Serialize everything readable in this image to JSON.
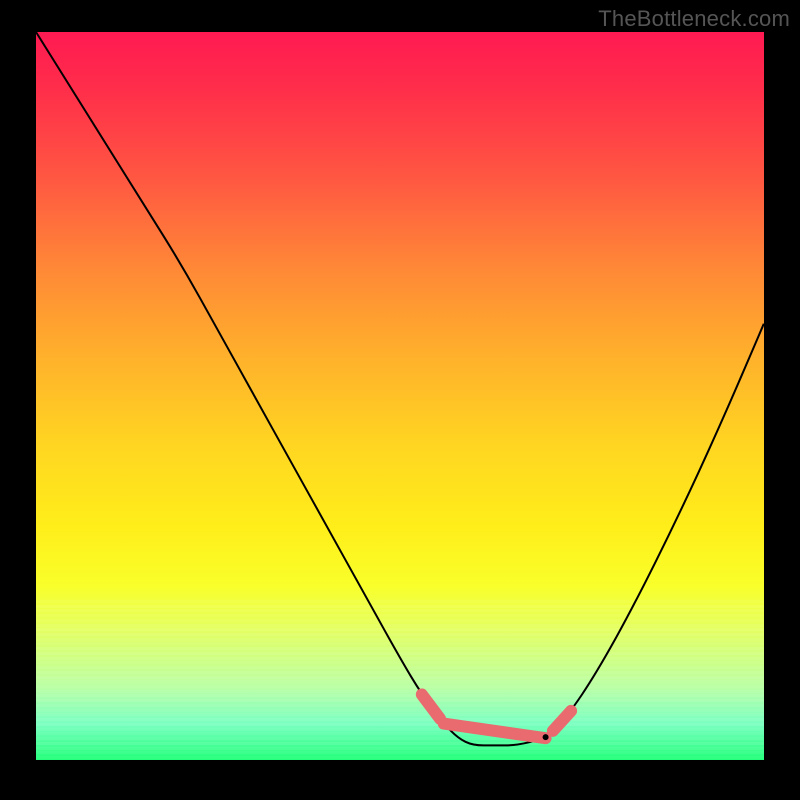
{
  "watermark": "TheBottleneck.com",
  "chart_data": {
    "type": "line",
    "title": "",
    "xlabel": "",
    "ylabel": "",
    "xlim": [
      0,
      100
    ],
    "ylim": [
      0,
      100
    ],
    "grid": false,
    "legend": false,
    "background_gradient": {
      "top_color": "#ff1a52",
      "bottom_color": "#22ff7a",
      "semantics": "red=high bottleneck, green=low bottleneck"
    },
    "series": [
      {
        "name": "bottleneck-curve",
        "color": "#000000",
        "x": [
          0,
          5,
          10,
          15,
          20,
          25,
          30,
          35,
          40,
          45,
          50,
          53,
          56,
          58,
          60,
          63,
          66,
          70,
          73,
          77,
          82,
          88,
          94,
          100
        ],
        "values": [
          100,
          92,
          84,
          76,
          68,
          59,
          50,
          41,
          32,
          23,
          14,
          9,
          5,
          3,
          2,
          2,
          2,
          3,
          6,
          12,
          21,
          33,
          46,
          60
        ]
      }
    ],
    "highlighted_region": {
      "name": "optimal-range",
      "color": "#e96a6f",
      "x_start": 53,
      "x_end": 73,
      "y_min": 2,
      "y_max": 9
    },
    "annotations": []
  },
  "colors": {
    "frame": "#000000",
    "curve": "#000000",
    "marker": "#e96a6f"
  }
}
